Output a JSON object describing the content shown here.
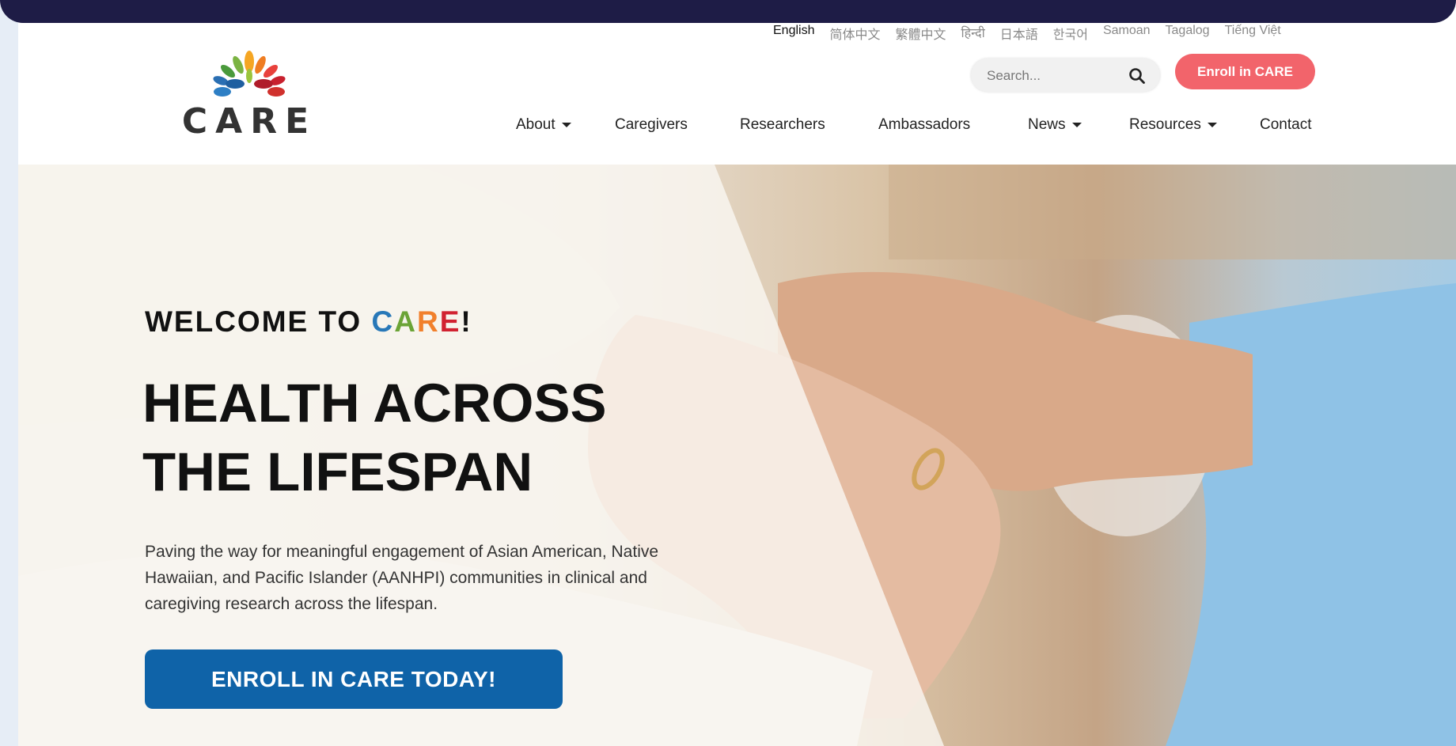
{
  "languages": [
    "English",
    "简体中文",
    "繁體中文",
    "हिन्दी",
    "日本語",
    "한국어",
    "Samoan",
    "Tagalog",
    "Tiếng Việt"
  ],
  "logo": {
    "text": "CARE"
  },
  "search": {
    "placeholder": "Search..."
  },
  "enroll_button": "Enroll in CARE",
  "nav": {
    "about": "About",
    "caregivers": "Caregivers",
    "researchers": "Researchers",
    "ambassadors": "Ambassadors",
    "news": "News",
    "resources": "Resources",
    "contact": "Contact"
  },
  "hero": {
    "welcome_prefix": "WELCOME TO ",
    "welcome_letters": [
      "C",
      "A",
      "R",
      "E"
    ],
    "welcome_suffix": "!",
    "headline_line1": "HEALTH ACROSS",
    "headline_line2": "THE LIFESPAN",
    "description": "Paving the way for meaningful engagement of Asian American, Native Hawaiian, and Pacific Islander (AANHPI) communities in clinical and caregiving research across the lifespan.",
    "cta": "ENROLL IN CARE TODAY!"
  },
  "colors": {
    "topbar": "#1e1c46",
    "enroll_button": "#f2646b",
    "cta": "#0f63a8",
    "care_c": "#2878b8",
    "care_a": "#6ba437",
    "care_r": "#f1802c",
    "care_e": "#d12231"
  }
}
